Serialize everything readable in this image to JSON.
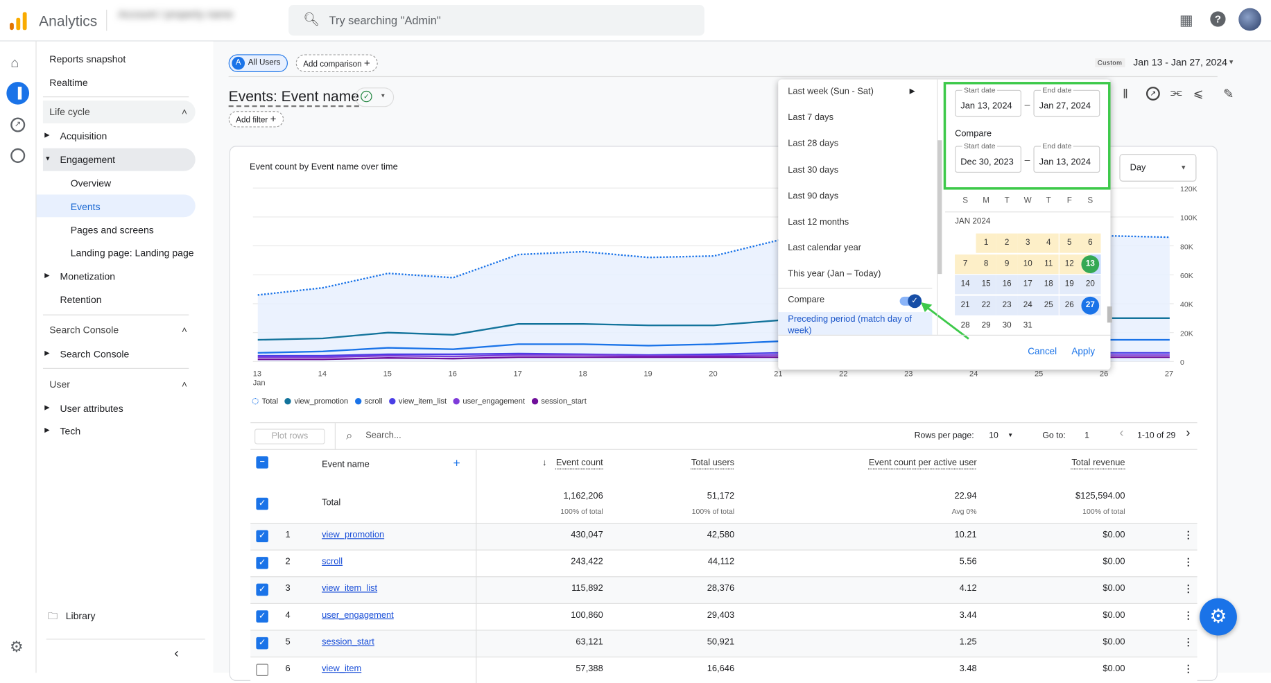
{
  "header": {
    "app_name": "Analytics",
    "account_blurred": "Account / property name",
    "search_placeholder": "Try searching \"Admin\""
  },
  "sidebar": {
    "reports_snapshot": "Reports snapshot",
    "realtime": "Realtime",
    "sections": [
      {
        "label": "Life cycle",
        "items": [
          "Acquisition",
          "Engagement",
          "Monetization",
          "Retention"
        ],
        "engagement_sub": [
          "Overview",
          "Events",
          "Pages and screens",
          "Landing page: Landing page"
        ]
      },
      {
        "label": "Search Console",
        "items": [
          "Search Console"
        ]
      },
      {
        "label": "User",
        "items": [
          "User attributes",
          "Tech"
        ]
      }
    ],
    "library": "Library"
  },
  "comparisons": {
    "all_users": "All Users",
    "avatar_letter": "A",
    "add_comparison": "Add comparison"
  },
  "date_range": {
    "mode": "Custom",
    "value": "Jan 13 - Jan 27, 2024"
  },
  "page": {
    "title": "Events: Event name",
    "add_filter": "Add filter"
  },
  "popup": {
    "presets": [
      "Last week (Sun - Sat)",
      "Last 7 days",
      "Last 28 days",
      "Last 30 days",
      "Last 90 days",
      "Last 12 months",
      "Last calendar year",
      "This year (Jan – Today)"
    ],
    "compare_label": "Compare",
    "compare_on": true,
    "compare_option": "Preceding period (match day of week)",
    "start_label": "Start date",
    "end_label": "End date",
    "start": "Jan 13, 2024",
    "end": "Jan 27, 2024",
    "compare_title": "Compare",
    "cmp_start": "Dec 30, 2023",
    "cmp_end": "Jan 13, 2024",
    "weekdays": [
      "S",
      "M",
      "T",
      "W",
      "T",
      "F",
      "S"
    ],
    "month": "JAN 2024",
    "cancel": "Cancel",
    "apply": "Apply",
    "highlight_color": "#3dc94a"
  },
  "granularity": "Day",
  "chart_data": {
    "type": "line",
    "title": "Event count by Event name over time",
    "x": [
      "13",
      "14",
      "15",
      "16",
      "17",
      "18",
      "19",
      "20",
      "21",
      "22",
      "23",
      "24",
      "25",
      "26",
      "27"
    ],
    "x_sub": "Jan",
    "y_ticks": [
      "0",
      "20K",
      "40K",
      "60K",
      "80K",
      "100K",
      "120K"
    ],
    "ylim": [
      0,
      120000
    ],
    "grid": true,
    "legend": "bottom-left",
    "series": [
      {
        "name": "Total",
        "color": "#1a73e8",
        "dotted": true,
        "values": [
          46000,
          51000,
          61000,
          58000,
          74000,
          76000,
          72000,
          73000,
          84000,
          85000,
          86000,
          87000,
          86000,
          87000,
          86000
        ]
      },
      {
        "name": "view_promotion",
        "color": "#12739b",
        "values": [
          15000,
          16000,
          20000,
          18500,
          26000,
          26000,
          25000,
          25000,
          28500,
          29000,
          29000,
          30000,
          29500,
          30000,
          30000
        ]
      },
      {
        "name": "scroll",
        "color": "#1a73e8",
        "values": [
          6000,
          7000,
          9500,
          8500,
          12000,
          12000,
          11000,
          12000,
          14000,
          14000,
          14500,
          15000,
          14500,
          15000,
          15000
        ]
      },
      {
        "name": "view_item_list",
        "color": "#4a3ee6",
        "values": [
          4000,
          4000,
          5000,
          5000,
          5500,
          5000,
          4500,
          5000,
          6000,
          6000,
          6000,
          6000,
          6000,
          6000,
          6000
        ]
      },
      {
        "name": "user_engagement",
        "color": "#7e3bd9",
        "values": [
          3000,
          3000,
          4000,
          3500,
          4500,
          4500,
          4000,
          4000,
          4500,
          4500,
          4500,
          4500,
          4500,
          4500,
          4500
        ]
      },
      {
        "name": "session_start",
        "color": "#6f0f9a",
        "values": [
          1500,
          1500,
          2500,
          2000,
          3000,
          3000,
          3000,
          3000,
          3000,
          3000,
          3000,
          3000,
          3000,
          3000,
          3000
        ]
      }
    ]
  },
  "table": {
    "plot_rows": "Plot rows",
    "search_placeholder": "Search...",
    "rows_per_page_label": "Rows per page:",
    "rows_per_page": "10",
    "goto_label": "Go to:",
    "goto": "1",
    "range": "1-10 of 29",
    "columns": [
      "Event name",
      "Event count",
      "Total users",
      "Event count per active user",
      "Total revenue"
    ],
    "total": {
      "label": "Total",
      "values": [
        "1,162,206",
        "51,172",
        "22.94",
        "$125,594.00"
      ],
      "subs": [
        "100% of total",
        "100% of total",
        "Avg 0%",
        "100% of total"
      ]
    },
    "rows": [
      {
        "n": "1",
        "name": "view_promotion",
        "vals": [
          "430,047",
          "42,580",
          "10.21",
          "$0.00"
        ],
        "checked": true
      },
      {
        "n": "2",
        "name": "scroll",
        "vals": [
          "243,422",
          "44,112",
          "5.56",
          "$0.00"
        ],
        "checked": true
      },
      {
        "n": "3",
        "name": "view_item_list",
        "vals": [
          "115,892",
          "28,376",
          "4.12",
          "$0.00"
        ],
        "checked": true
      },
      {
        "n": "4",
        "name": "user_engagement",
        "vals": [
          "100,860",
          "29,403",
          "3.44",
          "$0.00"
        ],
        "checked": true
      },
      {
        "n": "5",
        "name": "session_start",
        "vals": [
          "63,121",
          "50,921",
          "1.25",
          "$0.00"
        ],
        "checked": true
      },
      {
        "n": "6",
        "name": "view_item",
        "vals": [
          "57,388",
          "16,646",
          "3.48",
          "$0.00"
        ],
        "checked": false
      }
    ]
  }
}
